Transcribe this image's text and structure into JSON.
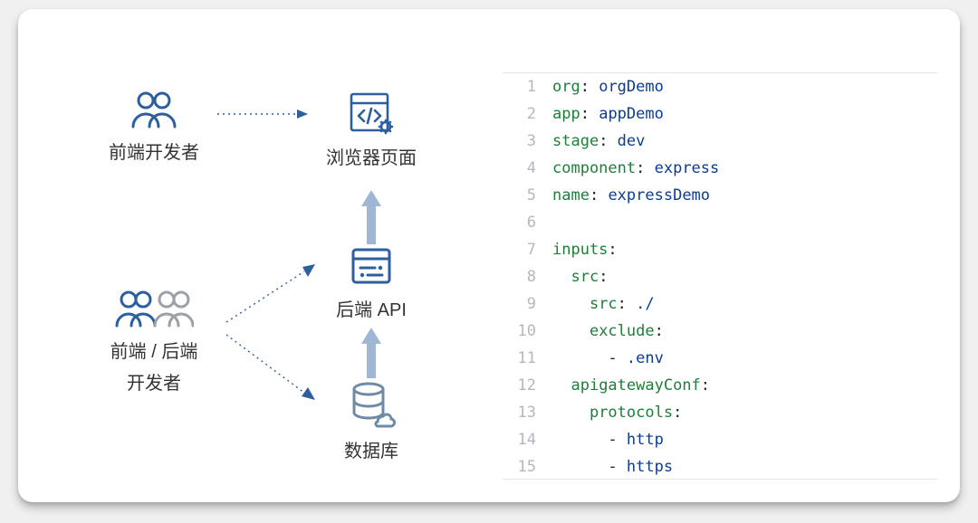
{
  "diagram": {
    "nodes": {
      "frontend_dev": {
        "label": "前端开发者"
      },
      "browser_page": {
        "label": "浏览器页面"
      },
      "fullstack_dev": {
        "label_line1": "前端 / 后端",
        "label_line2": "开发者"
      },
      "backend_api": {
        "label": "后端 API"
      },
      "database": {
        "label": "数据库"
      }
    }
  },
  "code": {
    "lines": [
      {
        "n": 1,
        "indent": 0,
        "key": "org",
        "value": "orgDemo"
      },
      {
        "n": 2,
        "indent": 0,
        "key": "app",
        "value": "appDemo"
      },
      {
        "n": 3,
        "indent": 0,
        "key": "stage",
        "value": "dev"
      },
      {
        "n": 4,
        "indent": 0,
        "key": "component",
        "value": "express"
      },
      {
        "n": 5,
        "indent": 0,
        "key": "name",
        "value": "expressDemo"
      },
      {
        "n": 6,
        "indent": 0,
        "blank": true
      },
      {
        "n": 7,
        "indent": 0,
        "key": "inputs",
        "colon_only": true
      },
      {
        "n": 8,
        "indent": 1,
        "key": "src",
        "colon_only": true
      },
      {
        "n": 9,
        "indent": 2,
        "key": "src",
        "value": "./"
      },
      {
        "n": 10,
        "indent": 2,
        "key": "exclude",
        "colon_only": true
      },
      {
        "n": 11,
        "indent": 3,
        "list_item": ".env"
      },
      {
        "n": 12,
        "indent": 1,
        "key": "apigatewayConf",
        "colon_only": true
      },
      {
        "n": 13,
        "indent": 2,
        "key": "protocols",
        "colon_only": true
      },
      {
        "n": 14,
        "indent": 3,
        "list_item": "http"
      },
      {
        "n": 15,
        "indent": 3,
        "list_item": "https"
      }
    ]
  }
}
